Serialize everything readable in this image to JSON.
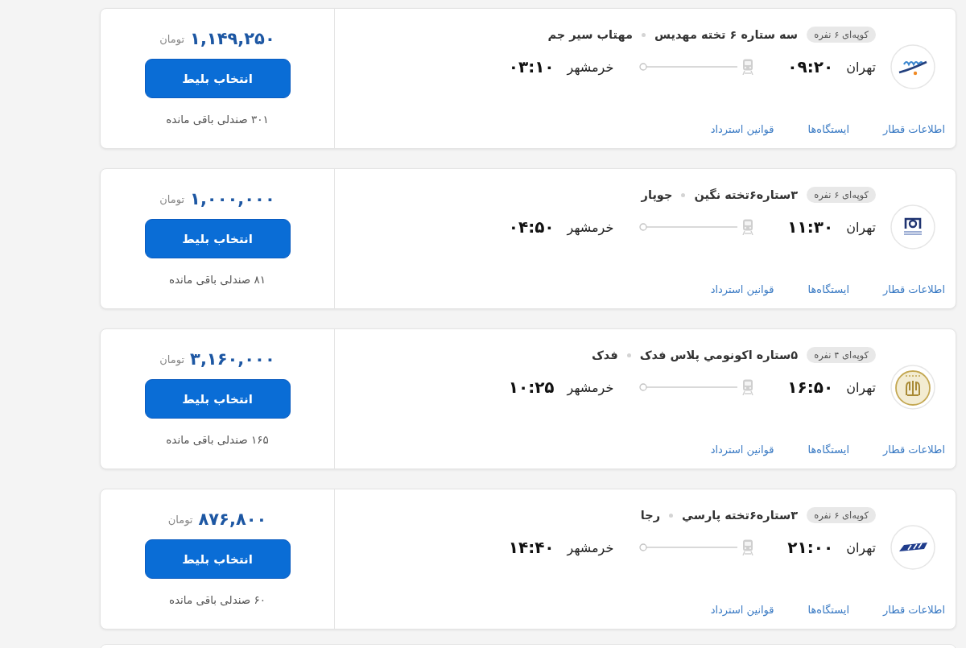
{
  "trips": [
    {
      "coach_type": "کوپه‌ای ۶ نفره",
      "train_name": "سه ستاره ۶ تخته مهدیس",
      "company": "مهتاب سیر جم",
      "origin": "تهران",
      "departure_time": "۰۹:۲۰",
      "destination": "خرمشهر",
      "arrival_time": "۰۳:۱۰",
      "links": [
        "اطلاعات قطار",
        "ایستگاه‌ها",
        "قوانین استرداد"
      ],
      "price": "۱,۱۴۹,۲۵۰",
      "currency": "تومان",
      "button": "انتخاب بلیط",
      "seats_left": "۳۰۱ صندلی باقی مانده"
    },
    {
      "coach_type": "کوپه‌ای ۶ نفره",
      "train_name": "۳ستاره۶تخته نگین",
      "company": "جوپار",
      "origin": "تهران",
      "departure_time": "۱۱:۳۰",
      "destination": "خرمشهر",
      "arrival_time": "۰۴:۵۰",
      "links": [
        "اطلاعات قطار",
        "ایستگاه‌ها",
        "قوانین استرداد"
      ],
      "price": "۱,۰۰۰,۰۰۰",
      "currency": "تومان",
      "button": "انتخاب بلیط",
      "seats_left": "۸۱ صندلی باقی مانده"
    },
    {
      "coach_type": "کوپه‌ای ۴ نفره",
      "train_name": "۵ستاره اکونومي پلاس فدک",
      "company": "فدک",
      "origin": "تهران",
      "departure_time": "۱۶:۵۰",
      "destination": "خرمشهر",
      "arrival_time": "۱۰:۲۵",
      "links": [
        "اطلاعات قطار",
        "ایستگاه‌ها",
        "قوانین استرداد"
      ],
      "price": "۳,۱۶۰,۰۰۰",
      "currency": "تومان",
      "button": "انتخاب بلیط",
      "seats_left": "۱۶۵ صندلی باقی مانده"
    },
    {
      "coach_type": "کوپه‌ای ۶ نفره",
      "train_name": "۳ستاره۶تخته پارسي",
      "company": "رجا",
      "origin": "تهران",
      "departure_time": "۲۱:۰۰",
      "destination": "خرمشهر",
      "arrival_time": "۱۴:۴۰",
      "links": [
        "اطلاعات قطار",
        "ایستگاه‌ها",
        "قوانین استرداد"
      ],
      "price": "۸۷۶,۸۰۰",
      "currency": "تومان",
      "button": "انتخاب بلیط",
      "seats_left": "۶۰ صندلی باقی مانده"
    }
  ]
}
